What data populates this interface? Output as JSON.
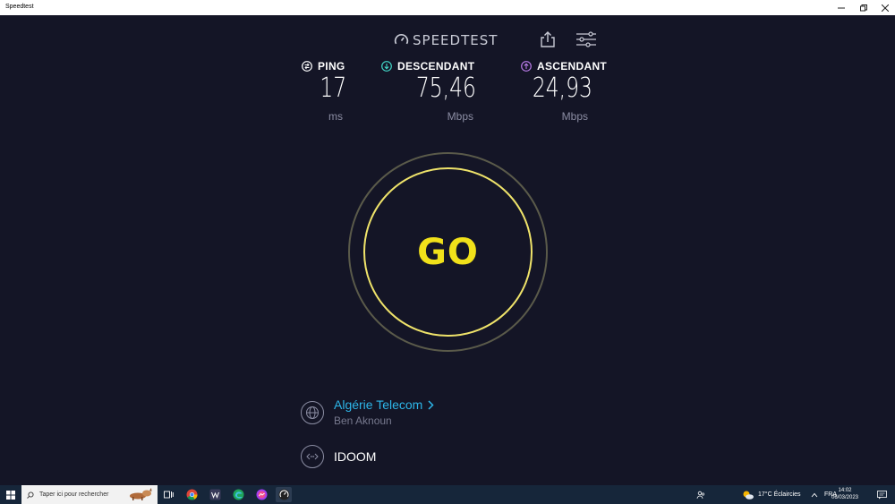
{
  "window": {
    "title": "Speedtest"
  },
  "app": {
    "logo_text": "SPEEDTEST",
    "metrics": {
      "ping": {
        "label": "PING",
        "value": "17",
        "unit": "ms"
      },
      "download": {
        "label": "DESCENDANT",
        "value": "75,46",
        "unit": "Mbps"
      },
      "upload": {
        "label": "ASCENDANT",
        "value": "24,93",
        "unit": "Mbps"
      }
    },
    "go_label": "GO",
    "server": {
      "isp": "Algérie Telecom",
      "location": "Ben Aknoun"
    },
    "host": {
      "name": "IDOOM"
    },
    "colors": {
      "background": "#141526",
      "accent_go": "#f1e11a",
      "isp_link": "#2db6e9",
      "ping_icon": "#ffffff",
      "download_icon": "#42d6c6",
      "upload_icon": "#b97be8"
    }
  },
  "taskbar": {
    "search_placeholder": "Taper ici pour rechercher",
    "weather": "17°C  Éclaircies",
    "language": "FRA",
    "time": "14:02",
    "date": "06/03/2023"
  }
}
